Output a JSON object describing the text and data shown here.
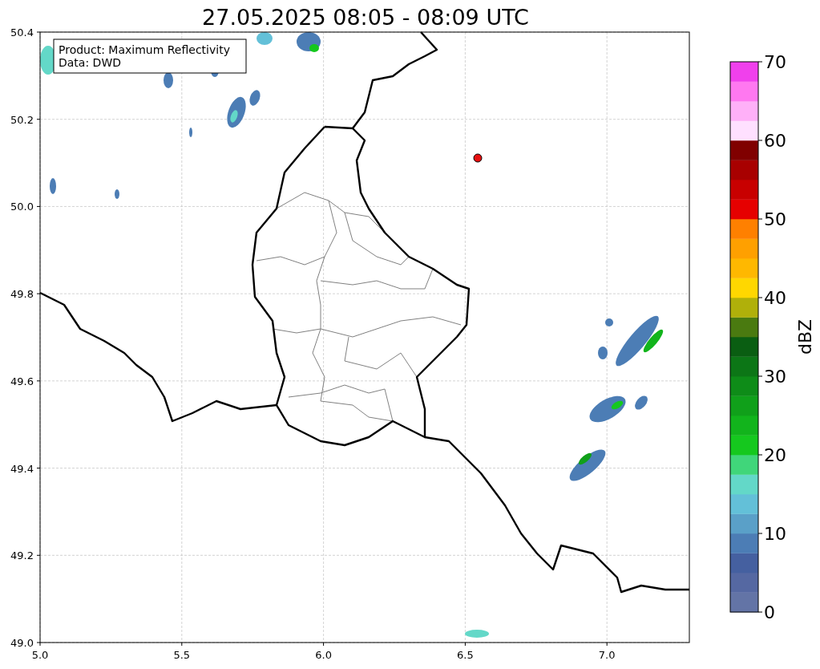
{
  "title": "27.05.2025 08:05 - 08:09 UTC",
  "info_box": [
    "Product: Maximum Reflectivity",
    "Data: DWD"
  ],
  "map": {
    "x_ticks": [
      "5.0",
      "5.5",
      "6.0",
      "6.5",
      "7.0"
    ],
    "y_ticks": [
      "50.4",
      "50.2",
      "50.0",
      "49.8",
      "49.6",
      "49.4",
      "49.2",
      "49.0"
    ]
  },
  "colorbar": {
    "label": "dBZ",
    "ticks": [
      "70",
      "60",
      "50",
      "40",
      "30",
      "20",
      "10",
      "0"
    ],
    "segments": [
      {
        "color": "#6374a6"
      },
      {
        "color": "#5568a2"
      },
      {
        "color": "#4560a0"
      },
      {
        "color": "#4c7db5"
      },
      {
        "color": "#5aa0c8"
      },
      {
        "color": "#63c0d8"
      },
      {
        "color": "#63d8c8"
      },
      {
        "color": "#40d67a"
      },
      {
        "color": "#15c81e"
      },
      {
        "color": "#12b41c"
      },
      {
        "color": "#10a01a"
      },
      {
        "color": "#0e8c18"
      },
      {
        "color": "#0c7616"
      },
      {
        "color": "#0a5e12"
      },
      {
        "color": "#4a7a10"
      },
      {
        "color": "#b0b00a"
      },
      {
        "color": "#ffd700"
      },
      {
        "color": "#ffb800"
      },
      {
        "color": "#ffa000"
      },
      {
        "color": "#ff8000"
      },
      {
        "color": "#e60000"
      },
      {
        "color": "#c80000"
      },
      {
        "color": "#a80000"
      },
      {
        "color": "#800000"
      },
      {
        "color": "#ffe0ff"
      },
      {
        "color": "#ffb0f8"
      },
      {
        "color": "#ff78f0"
      },
      {
        "color": "#f040ec"
      }
    ]
  }
}
